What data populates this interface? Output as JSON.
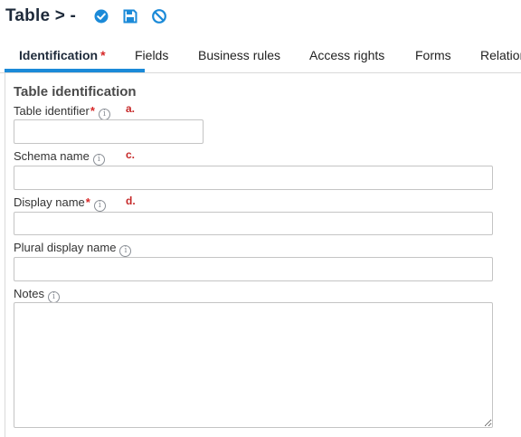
{
  "header": {
    "title": "Table > -",
    "actions": [
      {
        "name": "check-circle-icon",
        "color": "#1b8ad8"
      },
      {
        "name": "save-icon",
        "color": "#1b8ad8"
      },
      {
        "name": "cancel-icon",
        "color": "#1b8ad8"
      }
    ]
  },
  "tabs": [
    {
      "label": "Identification",
      "required_mark": "*",
      "active": true
    },
    {
      "label": "Fields"
    },
    {
      "label": "Business rules"
    },
    {
      "label": "Access rights"
    },
    {
      "label": "Forms"
    },
    {
      "label": "Relation"
    }
  ],
  "form": {
    "section_title": "Table identification",
    "required_mark": "*",
    "info_glyph": "i",
    "fields": {
      "table_identifier": {
        "label": "Table identifier",
        "annotation": "a.",
        "value": ""
      },
      "schema_name": {
        "label": "Schema name",
        "annotation": "c.",
        "value": ""
      },
      "display_name": {
        "label": "Display name",
        "annotation": "d.",
        "value": ""
      },
      "plural_display_name": {
        "label": "Plural display name",
        "value": ""
      },
      "notes": {
        "label": "Notes",
        "value": ""
      }
    }
  },
  "colors": {
    "accent": "#1b8ad8",
    "required": "#d62828",
    "annotation": "#c62828",
    "title": "#1e2a3a"
  }
}
